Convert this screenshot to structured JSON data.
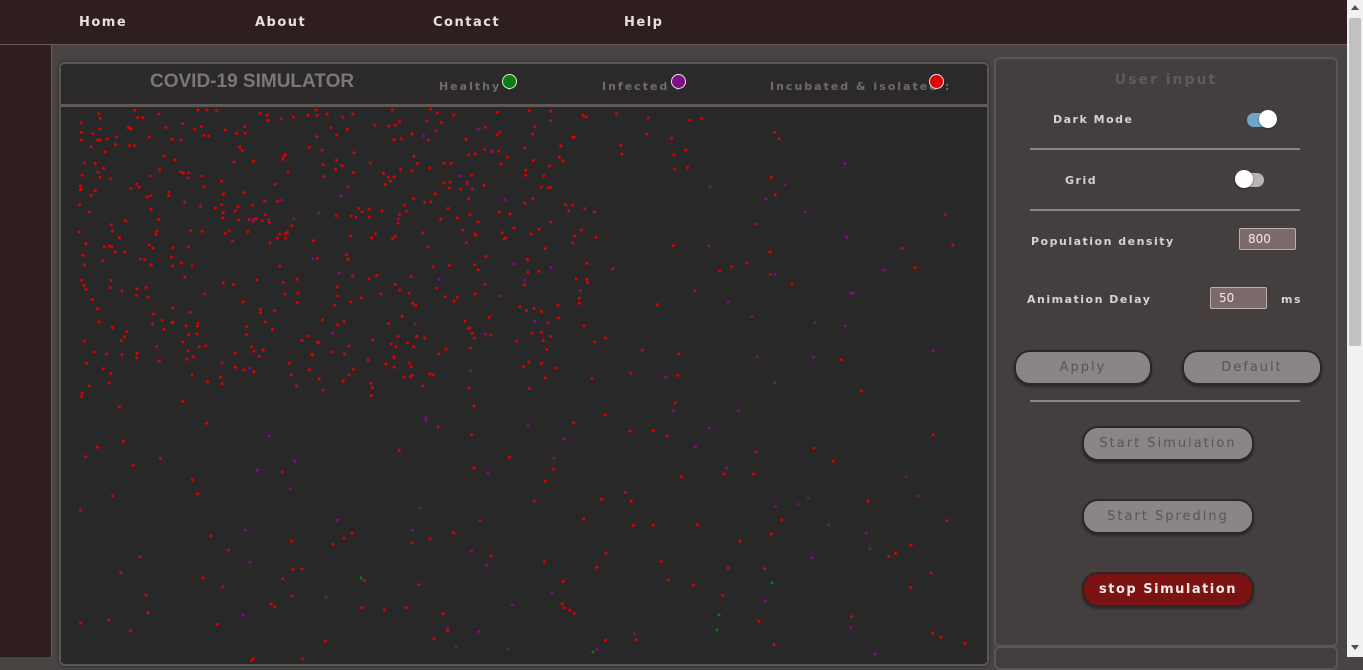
{
  "nav": {
    "items": [
      "Home",
      "About",
      "Contact",
      "Help"
    ]
  },
  "simulator": {
    "title": "COVID-19 SIMULATOR",
    "legend": [
      {
        "label": "Healthy :",
        "color": "#0a7d12"
      },
      {
        "label": "Infected :",
        "color": "#7e0f86"
      },
      {
        "label": "Incubated & isolated :",
        "color": "#e00000"
      }
    ]
  },
  "panel": {
    "title": "User input",
    "dark_mode_label": "Dark Mode",
    "dark_mode_on": true,
    "grid_label": "Grid",
    "grid_on": false,
    "population_label": "Population density",
    "population_value": "800",
    "delay_label": "Animation Delay",
    "delay_value": "50",
    "delay_unit": "ms",
    "apply_label": "Apply",
    "default_label": "Default",
    "start_sim_label": "Start Simulation",
    "start_spread_label": "Start Spreding",
    "stop_sim_label": "stop Simulation"
  },
  "colors": {
    "nav_bg": "#2e1e20",
    "page_bg": "#484444",
    "canvas_bg": "#282828",
    "healthy": "#0a7d12",
    "infected": "#7e0f86",
    "isolated": "#e00000",
    "stop_button": "#7c1313"
  }
}
